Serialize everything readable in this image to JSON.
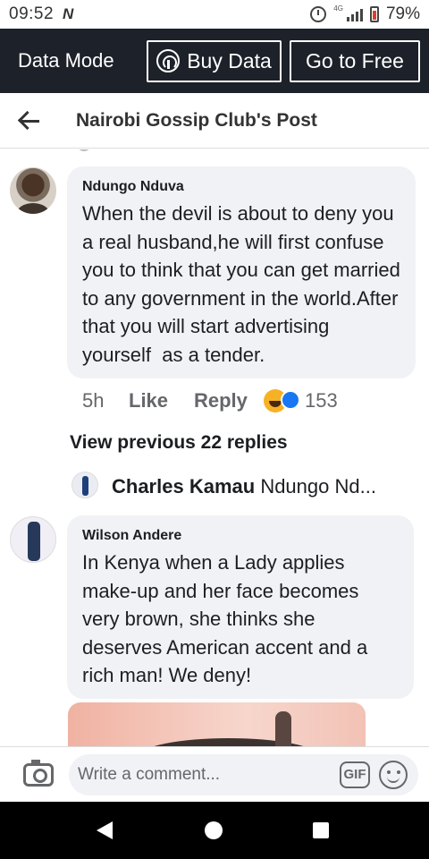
{
  "status_bar": {
    "time": "09:52",
    "carrier_logo": "N",
    "network": "lte",
    "battery_percent": "79%",
    "battery_level": 0.79
  },
  "data_bar": {
    "mode_label": "Data Mode",
    "buy_data_label": "Buy Data",
    "go_free_label": "Go to Free",
    "background_color": "#1d2129"
  },
  "header": {
    "title": "Nairobi Gossip Club's Post"
  },
  "comments": [
    {
      "author": "Ndungo Nduva",
      "text": "When the devil is about to deny you a real husband,he will first confuse you to think that you can get married to any government in the world.After that you will start advertising yourself  as a tender.",
      "time": "5h",
      "like_label": "Like",
      "reply_label": "Reply",
      "reaction_count": "153",
      "reactions": [
        "haha-icon",
        "like-icon"
      ]
    },
    {
      "author": "Wilson Andere",
      "text": "In Kenya when a Lady applies make-up and her face becomes very brown, she thinks she deserves American accent and a rich man! We deny!"
    }
  ],
  "thread": {
    "view_previous_label": "View previous 22 replies",
    "latest_reply_author": "Charles Kamau",
    "latest_reply_text": "Ndungo Nd..."
  },
  "composer": {
    "placeholder": "Write a comment...",
    "gif_label": "GIF"
  }
}
